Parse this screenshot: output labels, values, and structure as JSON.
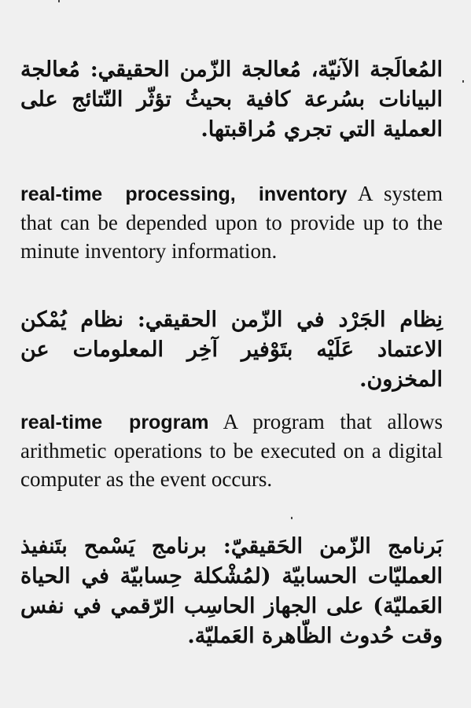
{
  "entries": [
    {
      "arabic_term": "المُعالَجة الآنيّة، مُعالجة الزّمن الحقيقي:",
      "arabic_definition": "مُعالجة البيانات بسُرعة كافية بحيثُ تؤثّر النّتائج على العملية التي تجري مُراقبتها."
    },
    {
      "english_term": "real-time processing, inventory",
      "english_definition": "A system that can be depended upon to provide up to the minute inventory information.",
      "arabic_term": "نِظام الجَرْد في الزّمن الحقيقي:",
      "arabic_definition": "نظام يُمْكن الاعتماد عَلَيْه بتَوْفير آخِر المعلومات عن المخزون."
    },
    {
      "english_term": "real-time program",
      "english_definition": "A program that allows arithmetic operations to be executed on a digital computer as the event occurs.",
      "arabic_term": "بَرنامج الزّمن الحَقيقيّ:",
      "arabic_definition": "برنامج يَسْمح بتَنفيذ العمليّات الحسابيّة (لمُشْكلة حِسابيّة في الحياة العَمليّة) على الجهاز الحاسِب الرّقمي في نفس وقت حُدوث الظّاهرة العَمليّة."
    }
  ]
}
